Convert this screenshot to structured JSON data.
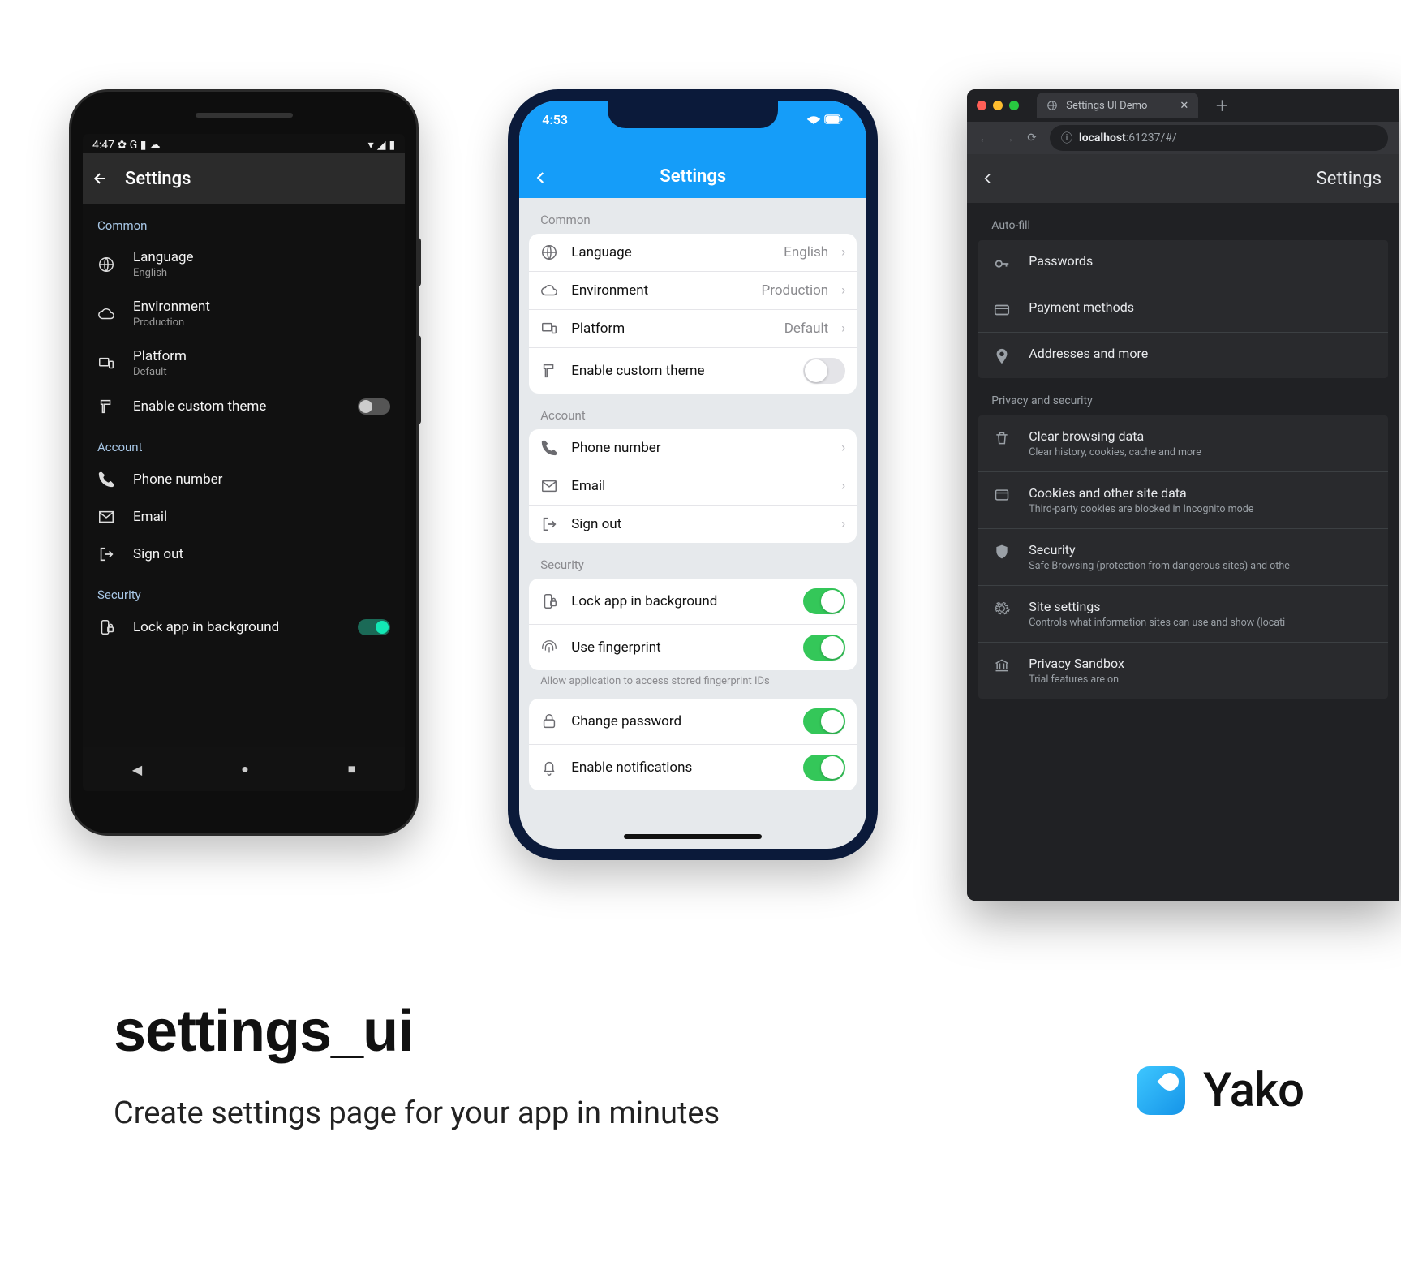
{
  "marketing": {
    "title": "settings_ui",
    "subtitle": "Create settings page for your app in minutes",
    "brand": "Yako"
  },
  "android": {
    "status_time": "4:47",
    "title": "Settings",
    "sections": {
      "common": {
        "label": "Common",
        "language": {
          "title": "Language",
          "sub": "English"
        },
        "environment": {
          "title": "Environment",
          "sub": "Production"
        },
        "platform": {
          "title": "Platform",
          "sub": "Default"
        },
        "theme": {
          "title": "Enable custom theme"
        }
      },
      "account": {
        "label": "Account",
        "phone": {
          "title": "Phone number"
        },
        "email": {
          "title": "Email"
        },
        "signout": {
          "title": "Sign out"
        }
      },
      "security": {
        "label": "Security",
        "lock": {
          "title": "Lock app in background"
        }
      }
    }
  },
  "ios": {
    "status_time": "4:53",
    "title": "Settings",
    "sections": {
      "common": {
        "label": "Common",
        "language": {
          "title": "Language",
          "value": "English"
        },
        "environment": {
          "title": "Environment",
          "value": "Production"
        },
        "platform": {
          "title": "Platform",
          "value": "Default"
        },
        "theme": {
          "title": "Enable custom theme"
        }
      },
      "account": {
        "label": "Account",
        "phone": {
          "title": "Phone number"
        },
        "email": {
          "title": "Email"
        },
        "signout": {
          "title": "Sign out"
        }
      },
      "security": {
        "label": "Security",
        "lock": {
          "title": "Lock app in background"
        },
        "fingerprint": {
          "title": "Use fingerprint"
        },
        "note": "Allow application to access stored fingerprint IDs",
        "password": {
          "title": "Change password"
        },
        "notifications": {
          "title": "Enable notifications"
        }
      }
    }
  },
  "browser": {
    "tab_title": "Settings UI Demo",
    "url_host": "localhost",
    "url_path": ":61237/#/",
    "app_title": "Settings",
    "sections": {
      "autofill": {
        "label": "Auto-fill",
        "passwords": {
          "title": "Passwords"
        },
        "payment": {
          "title": "Payment methods"
        },
        "addresses": {
          "title": "Addresses and more"
        }
      },
      "privacy": {
        "label": "Privacy and security",
        "clear": {
          "title": "Clear browsing data",
          "sub": "Clear history, cookies, cache and more"
        },
        "cookies": {
          "title": "Cookies and other site data",
          "sub": "Third-party cookies are blocked in Incognito mode"
        },
        "security": {
          "title": "Security",
          "sub": "Safe Browsing (protection from dangerous sites) and othe"
        },
        "site": {
          "title": "Site settings",
          "sub": "Controls what information sites can use and show (locati"
        },
        "sandbox": {
          "title": "Privacy Sandbox",
          "sub": "Trial features are on"
        }
      }
    }
  }
}
